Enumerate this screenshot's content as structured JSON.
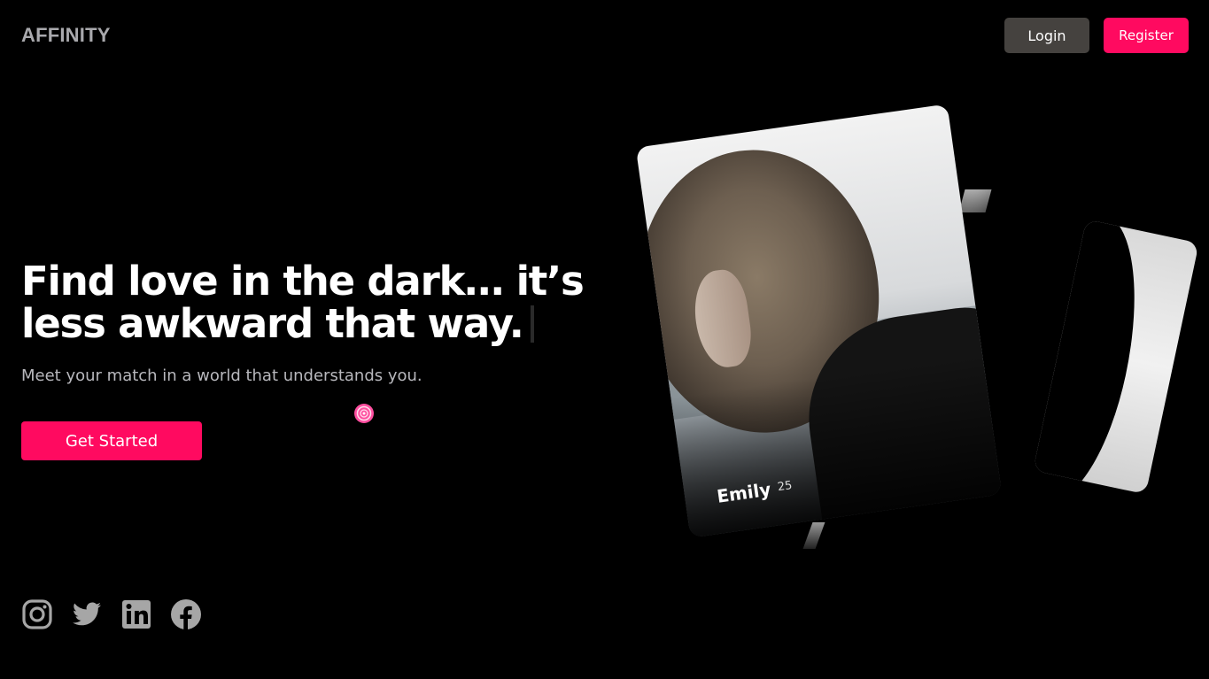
{
  "brand": {
    "logo": "AFFINITY"
  },
  "nav": {
    "login_label": "Login",
    "register_label": "Register"
  },
  "hero": {
    "headline_line1": "Find love in the dark… it’s",
    "headline_line2": "less awkward that way.",
    "subheading": "Meet your match in a world that understands you.",
    "cta_label": "Get Started"
  },
  "profile_card": {
    "name": "Emily",
    "age": "25"
  },
  "social": {
    "icons": [
      "instagram-icon",
      "twitter-icon",
      "linkedin-icon",
      "facebook-icon"
    ]
  },
  "colors": {
    "accent": "#ff0a60",
    "login_bg": "#45423f",
    "logo": "#a9a9ad",
    "muted_text": "#b8b8bd",
    "icon": "#a6a6a6",
    "background": "#000000"
  }
}
